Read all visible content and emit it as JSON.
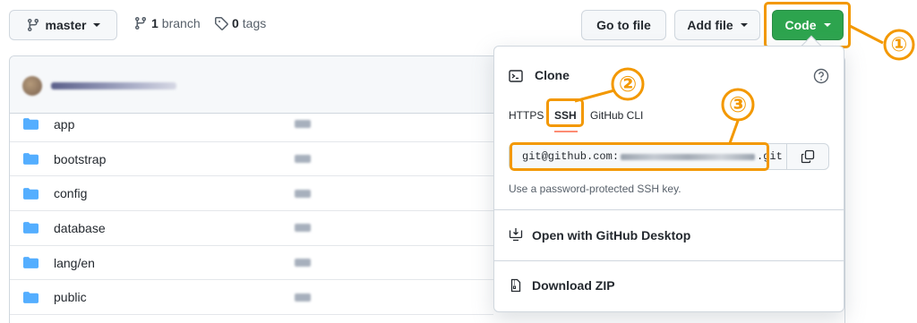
{
  "toolbar": {
    "branch_select": "master",
    "branch_count": "1",
    "branch_word": "branch",
    "tag_count": "0",
    "tag_word": "tags",
    "go_to_file": "Go to file",
    "add_file": "Add file",
    "code": "Code"
  },
  "files": [
    {
      "name": "app"
    },
    {
      "name": "bootstrap"
    },
    {
      "name": "config"
    },
    {
      "name": "database"
    },
    {
      "name": "lang/en"
    },
    {
      "name": "public"
    }
  ],
  "clone": {
    "title": "Clone",
    "tabs": [
      "HTTPS",
      "SSH",
      "GitHub CLI"
    ],
    "active_tab": "SSH",
    "url_prefix": "git@github.com:",
    "url_suffix": ".git",
    "hint": "Use a password-protected SSH key.",
    "open_desktop": "Open with GitHub Desktop",
    "download_zip": "Download ZIP"
  },
  "annotations": [
    "①",
    "②",
    "③"
  ],
  "colors": {
    "accent_orange": "#f39800",
    "code_green": "#2da44e",
    "folder_blue": "#54aeff",
    "tab_underline": "#fd8c73"
  }
}
